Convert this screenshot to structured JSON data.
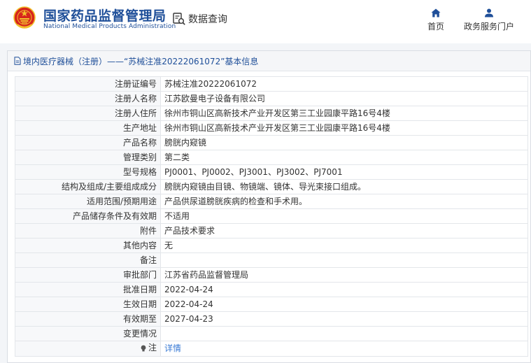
{
  "header": {
    "org_name_cn": "国家药品监督管理局",
    "org_name_en": "National Medical Products Administration",
    "data_query": "数据查询",
    "nav": [
      {
        "label": "首页",
        "icon": "home-icon"
      },
      {
        "label": "政务服务门户",
        "icon": "user-icon"
      }
    ]
  },
  "colors": {
    "brand": "#1f4f99",
    "link": "#3a7bd5",
    "emblem_red": "#d7261c",
    "emblem_gold": "#f2c22e"
  },
  "panel": {
    "title": "境内医疗器械（注册）——“苏械注准20222061072”基本信息"
  },
  "rows": [
    {
      "label": "注册证编号",
      "value": "苏械注准20222061072"
    },
    {
      "label": "注册人名称",
      "value": "江苏欧曼电子设备有限公司"
    },
    {
      "label": "注册人住所",
      "value": "徐州市铜山区高新技术产业开发区第三工业园康平路16号4楼"
    },
    {
      "label": "生产地址",
      "value": "徐州市铜山区高新技术产业开发区第三工业园康平路16号4楼"
    },
    {
      "label": "产品名称",
      "value": "膀胱内窥镜"
    },
    {
      "label": "管理类别",
      "value": "第二类"
    },
    {
      "label": "型号规格",
      "value": "PJ0001、PJ0002、PJ3001、PJ3002、PJ7001"
    },
    {
      "label": "结构及组成/主要组成成分",
      "value": "膀胱内窥镜由目镜、物镜端、镜体、导光束接口组成。"
    },
    {
      "label": "适用范围/预期用途",
      "value": "产品供尿道膀胱疾病的检查和手术用。"
    },
    {
      "label": "产品储存条件及有效期",
      "value": "不适用"
    },
    {
      "label": "附件",
      "value": "产品技术要求"
    },
    {
      "label": "其他内容",
      "value": "无"
    },
    {
      "label": "备注",
      "value": ""
    },
    {
      "label": "审批部门",
      "value": "江苏省药品监督管理局"
    },
    {
      "label": "批准日期",
      "value": "2022-04-24"
    },
    {
      "label": "生效日期",
      "value": "2022-04-24"
    },
    {
      "label": "有效期至",
      "value": "2027-04-23"
    },
    {
      "label": "变更情况",
      "value": ""
    }
  ],
  "note_row": {
    "label": "注",
    "icon": "bulb-icon",
    "value": "详情"
  }
}
